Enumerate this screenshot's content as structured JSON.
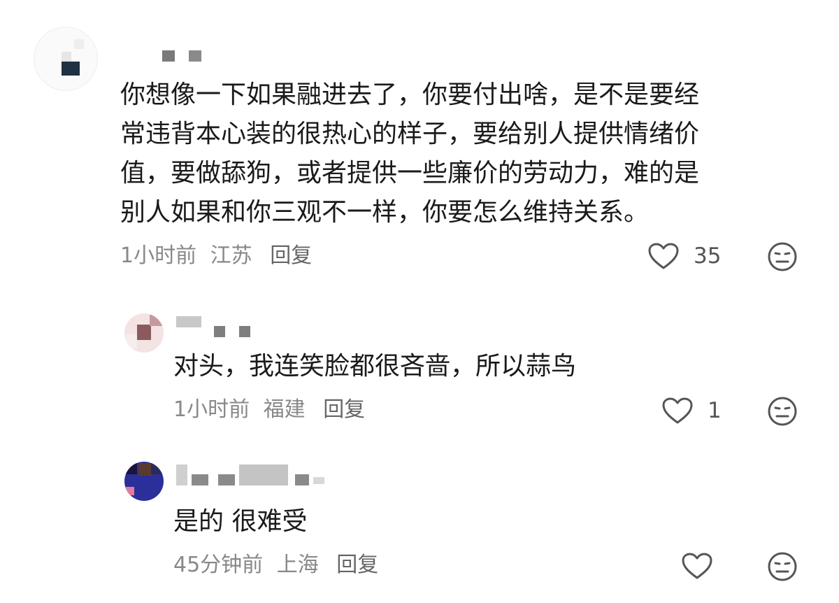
{
  "comments": [
    {
      "text_lines": [
        "你想像一下如果融进去了，你要付出啥，是不是要经",
        "常违背本心装的很热心的样子，要给别人提供情绪价",
        "值，要做舔狗，或者提供一些廉价的劳动力，难的是",
        "别人如果和你三观不一样，你要怎么维持关系。"
      ],
      "time": "1小时前",
      "location": "江苏",
      "reply_label": "回复",
      "like_count": "35"
    },
    {
      "text_lines": [
        "对头，我连笑脸都很吝啬，所以蒜鸟"
      ],
      "time": "1小时前",
      "location": "福建",
      "reply_label": "回复",
      "like_count": "1"
    },
    {
      "text_lines": [
        "是的 很难受"
      ],
      "time": "45分钟前",
      "location": "上海",
      "reply_label": "回复",
      "like_count": ""
    }
  ],
  "icons": {
    "like": "heart-outline-icon",
    "dislike": "meh-face-icon"
  },
  "colors": {
    "text": "#1a1a1a",
    "meta": "#888888",
    "icon": "#555555"
  }
}
